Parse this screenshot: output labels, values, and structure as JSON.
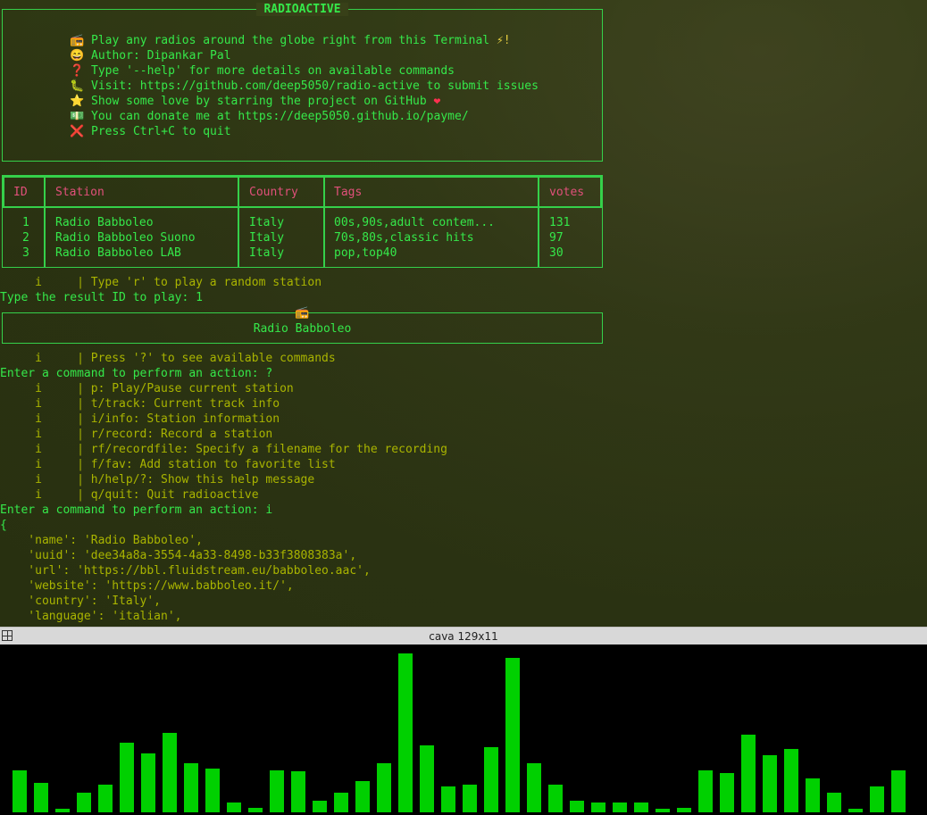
{
  "banner": {
    "title": "RADIOACTIVE",
    "lines": [
      {
        "icon": "📻",
        "icon_name": "radio-icon",
        "text": "Play any radios around the globe right from this Terminal ",
        "suffix": "⚡!",
        "suffix_name": "lightning-icon"
      },
      {
        "icon": "😄",
        "icon_name": "smile-icon",
        "text": "Author: Dipankar Pal"
      },
      {
        "icon": "❓",
        "icon_name": "question-icon",
        "text": "Type '--help' for more details on available commands"
      },
      {
        "icon": "🐛",
        "icon_name": "bug-icon",
        "text": "Visit: https://github.com/deep5050/radio-active to submit issues"
      },
      {
        "icon": "⭐",
        "icon_name": "star-icon",
        "text": "Show some love by starring the project on GitHub ",
        "suffix": "❤",
        "suffix_name": "heart-icon"
      },
      {
        "icon": "💵",
        "icon_name": "money-icon",
        "text": "You can donate me at https://deep5050.github.io/payme/"
      },
      {
        "icon": "❌",
        "icon_name": "cross-icon",
        "text": "Press Ctrl+C to quit"
      }
    ]
  },
  "table": {
    "headers": [
      "ID",
      "Station",
      "Country",
      "Tags",
      "votes"
    ],
    "rows": [
      [
        "1",
        "Radio Babboleo",
        "Italy",
        "00s,90s,adult contem...",
        "131"
      ],
      [
        "2",
        "Radio Babboleo Suono",
        "Italy",
        "70s,80s,classic hits",
        "97"
      ],
      [
        "3",
        "Radio Babboleo LAB",
        "Italy",
        "pop,top40",
        "30"
      ]
    ]
  },
  "hint_random": "     i     | Type 'r' to play a random station",
  "prompt_id": "Type the result ID to play: 1",
  "now_playing": {
    "icon": "📻",
    "name": "Radio Babboleo"
  },
  "hint_help": "     i     | Press '?' to see available commands",
  "prompt_cmd1": "Enter a command to perform an action: ?",
  "help_lines": [
    "     i     | p: Play/Pause current station",
    "     i     | t/track: Current track info",
    "     i     | i/info: Station information",
    "     i     | r/record: Record a station",
    "     i     | rf/recordfile: Specify a filename for the recording",
    "     i     | f/fav: Add station to favorite list",
    "     i     | h/help/?: Show this help message",
    "     i     | q/quit: Quit radioactive"
  ],
  "prompt_cmd2": "Enter a command to perform an action: i",
  "json_open": "{",
  "info_lines": [
    "    'name': 'Radio Babboleo',",
    "    'uuid': 'dee34a8a-3554-4a33-8498-b33f3808383a',",
    "    'url': 'https://bbl.fluidstream.eu/babboleo.aac',",
    "    'website': 'https://www.babboleo.it/',",
    "    'country': 'Italy',",
    "    'language': 'italian',"
  ],
  "cava": {
    "title": "cava 129x11",
    "color": "#00d000",
    "levels": [
      0.26,
      0.18,
      0.02,
      0.12,
      0.17,
      0.43,
      0.36,
      0.49,
      0.3,
      0.27,
      0.06,
      0.03,
      0.26,
      0.25,
      0.07,
      0.12,
      0.19,
      0.3,
      0.98,
      0.41,
      0.16,
      0.17,
      0.4,
      0.95,
      0.3,
      0.17,
      0.07,
      0.06,
      0.06,
      0.06,
      0.02,
      0.03,
      0.26,
      0.24,
      0.48,
      0.35,
      0.39,
      0.21,
      0.12,
      0.02,
      0.16,
      0.26
    ]
  }
}
